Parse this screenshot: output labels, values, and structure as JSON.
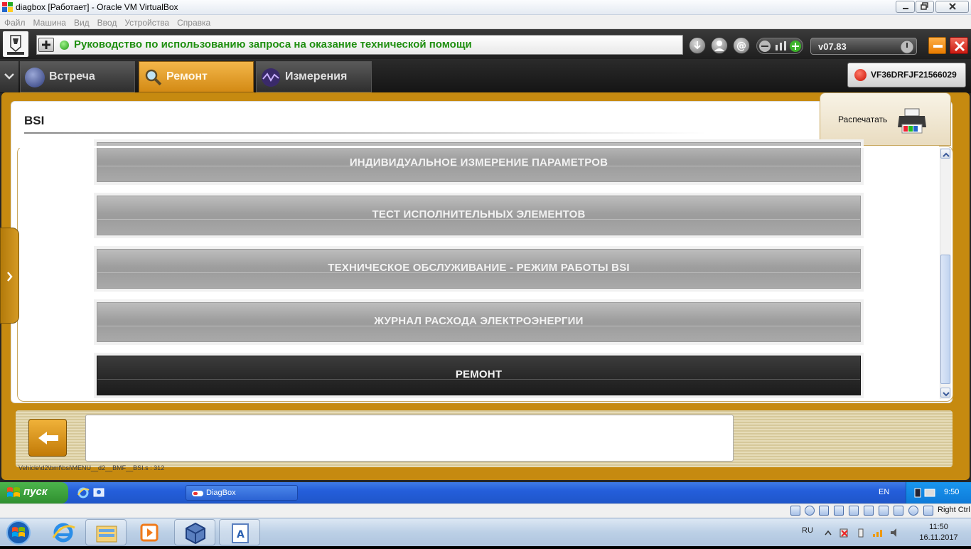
{
  "window": {
    "title": "diagbox [Работает] - Oracle VM VirtualBox"
  },
  "vbox_menu": [
    "Файл",
    "Машина",
    "Вид",
    "Ввод",
    "Устройства",
    "Справка"
  ],
  "app": {
    "header_message": "Руководство по использованию запроса на оказание технической помощи",
    "version": "v07.83",
    "tabs": [
      {
        "label": "Встреча",
        "active": false
      },
      {
        "label": "Ремонт",
        "active": true
      },
      {
        "label": "Измерения",
        "active": false
      }
    ],
    "vin": "VF36DRFJF21566029",
    "section_title": "BSI",
    "print_label": "Распечатать",
    "menu_items": [
      {
        "label": "ИНДИВИДУАЛЬНОЕ ИЗМЕРЕНИЕ ПАРАМЕТРОВ",
        "selected": false
      },
      {
        "label": "ТЕСТ ИСПОЛНИТЕЛЬНЫХ ЭЛЕМЕНТОВ",
        "selected": false
      },
      {
        "label": "ТЕХНИЧЕСКОЕ ОБСЛУЖИВАНИЕ - РЕЖИМ РАБОТЫ BSI",
        "selected": false
      },
      {
        "label": "ЖУРНАЛ РАСХОДА ЭЛЕКТРОЭНЕРГИИ",
        "selected": false
      },
      {
        "label": "РЕМОНТ",
        "selected": true
      }
    ],
    "status_path": "Vehicle\\d2\\bmf\\bsi\\MENU__d2__BMF__BSI.s : 312"
  },
  "guest_taskbar": {
    "start_label": "пуск",
    "task_label": "DiagBox",
    "lang": "EN",
    "time": "9:50"
  },
  "vbox_status": {
    "host_key": "Right Ctrl"
  },
  "host_taskbar": {
    "lang": "RU",
    "time": "11:50",
    "date": "16.11.2017"
  },
  "colors": {
    "accent_gold": "#c68a10",
    "message_green": "#1f8f10",
    "active_tab": "#e6a030",
    "xp_blue": "#245edb"
  }
}
